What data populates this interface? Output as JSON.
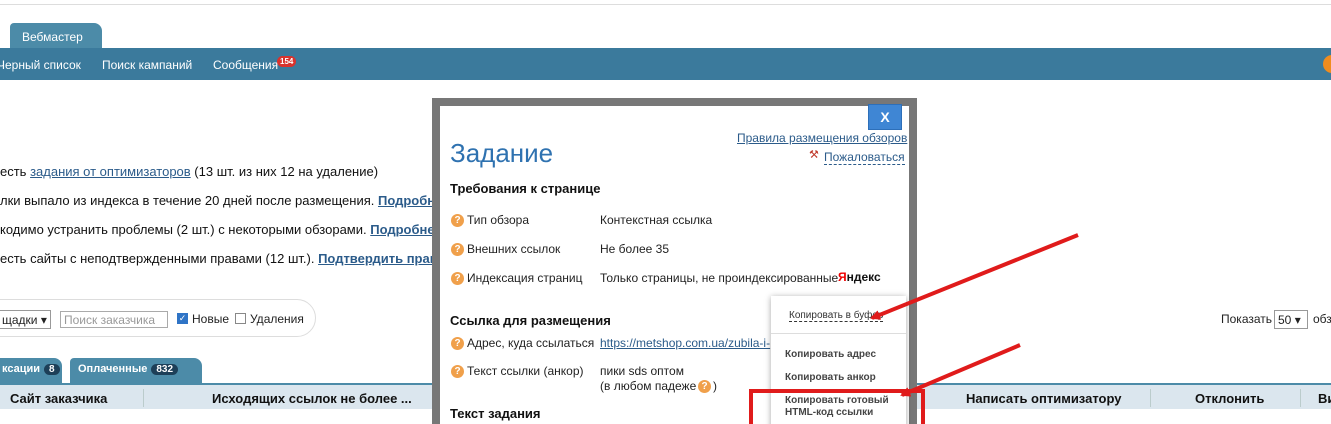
{
  "nav": {
    "tab": "Вебмастер",
    "items": [
      "Черный список",
      "Поиск кампаний",
      "Сообщения"
    ],
    "messages_badge": "154"
  },
  "notices": [
    {
      "pre": "есть ",
      "link": "задания от оптимизаторов",
      "post": " (13 шт. из них 12 на удаление)"
    },
    {
      "pre": "лки выпало из индекса в течение 20 дней после размещения. ",
      "link": "Подробне",
      "post": ""
    },
    {
      "pre": "кодимо устранить проблемы (2 шт.) с некоторыми обзорами. ",
      "link": "Подробнее",
      "post": ""
    },
    {
      "pre": "есть сайты с неподтвержденными правами (12 шт.). ",
      "link": "Подтвердить права",
      "post": ""
    }
  ],
  "filters": {
    "platform_select": "щадки",
    "search_placeholder": "Поиск заказчика",
    "cb_new": "Новые",
    "cb_delete": "Удаления",
    "show_label": "Показать",
    "show_value": "50",
    "show_tail": "обз"
  },
  "tabs": [
    {
      "label": "ксации",
      "count": "8"
    },
    {
      "label": "Оплаченные",
      "count": "832"
    }
  ],
  "table_headers": [
    "Сайт заказчика",
    "Исходящих ссылок не более ...",
    "Написать оптимизатору",
    "Отклонить",
    "Ви"
  ],
  "modal": {
    "close": "X",
    "title": "Задание",
    "rules_link": "Правила размещения обзоров",
    "complain_link": "Пожаловаться",
    "section_page": "Требования к странице",
    "rows_page": [
      {
        "label": "Тип обзора",
        "value": "Контекстная ссылка"
      },
      {
        "label": "Внешних ссылок",
        "value": "Не более 35"
      },
      {
        "label": "Индексация страниц",
        "value": "Только страницы, не проиндексированные"
      }
    ],
    "yandex": "Яндекс",
    "section_link": "Ссылка для размещения",
    "address_label": "Адрес, куда ссылаться",
    "address_value": "https://metshop.com.ua/zubila-i-",
    "anchor_label": "Текст ссылки (анкор)",
    "anchor_value": "пики sds оптом",
    "anchor_note": "(в любом падеже",
    "section_task": "Текст задания"
  },
  "copy_popup": {
    "copy_to_buffer": "Копировать в буфер",
    "items": [
      "Копировать адрес",
      "Копировать анкор",
      "Копировать готовый",
      "HTML-код ссылки"
    ]
  },
  "colors": {
    "nav": "#3b7a9c",
    "accent": "#2f72b0",
    "annotation": "#e01b1b"
  }
}
